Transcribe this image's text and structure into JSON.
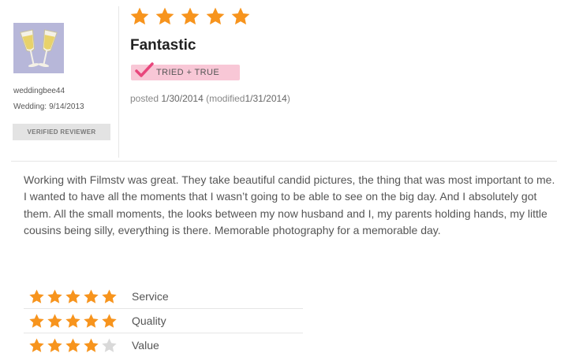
{
  "reviewer": {
    "username": "weddingbee44",
    "wedding_label": "Wedding:",
    "wedding_date": "9/14/2013",
    "verified_label": "VERIFIED REVIEWER",
    "avatar_icon": "champagne-glasses-icon"
  },
  "review": {
    "overall_rating": 5,
    "max_rating": 5,
    "title": "Fantastic",
    "badge_label": "TRIED + TRUE",
    "posted_prefix": "posted",
    "posted_date": "1/30/2014",
    "modified_prefix": "(modified",
    "modified_date": "1/31/2014",
    "modified_suffix": ")",
    "body": "Working with Filmstv was great. They take beautiful candid pictures, the thing that was most important to me. I wanted to have all the moments that I wasn’t going to be able to see on the big day. And I absolutely got them. All the small moments, the looks between my now husband and I, my parents holding hands, my little cousins being silly, everything is there. Memorable photography for a memorable day."
  },
  "ratings": [
    {
      "label": "Service",
      "value": 5
    },
    {
      "label": "Quality",
      "value": 5
    },
    {
      "label": "Value",
      "value": 4
    }
  ],
  "colors": {
    "star_filled": "#f7941d",
    "star_empty": "#d9d9d9",
    "badge_bg": "#f8c7d6",
    "badge_check": "#e8467c"
  }
}
